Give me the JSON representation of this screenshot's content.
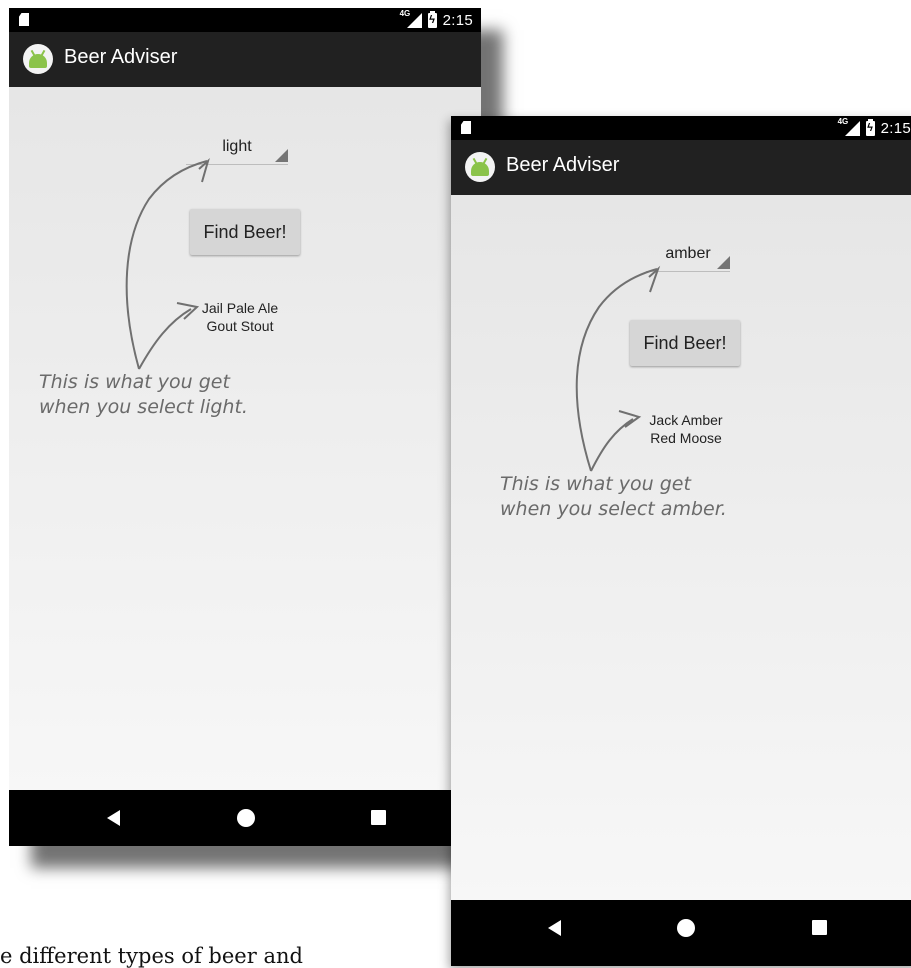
{
  "screens": [
    {
      "status": {
        "network": "4G",
        "time": "2:15"
      },
      "app_title": "Beer Adviser",
      "spinner_value": "light",
      "button_label": "Find Beer!",
      "brands": [
        "Jail Pale Ale",
        "Gout Stout"
      ],
      "note": [
        "This is what you get",
        "when you select light."
      ]
    },
    {
      "status": {
        "network": "4G",
        "time": "2:15"
      },
      "app_title": "Beer Adviser",
      "spinner_value": "amber",
      "button_label": "Find Beer!",
      "brands": [
        "Jack Amber",
        "Red Moose"
      ],
      "note": [
        "This is what you get",
        "when you select amber."
      ]
    }
  ],
  "page_text": "e different types of beer and",
  "colors": {
    "appbar": "#212121",
    "annotation": "#6a6a6a",
    "android_green": "#8bc34a"
  }
}
